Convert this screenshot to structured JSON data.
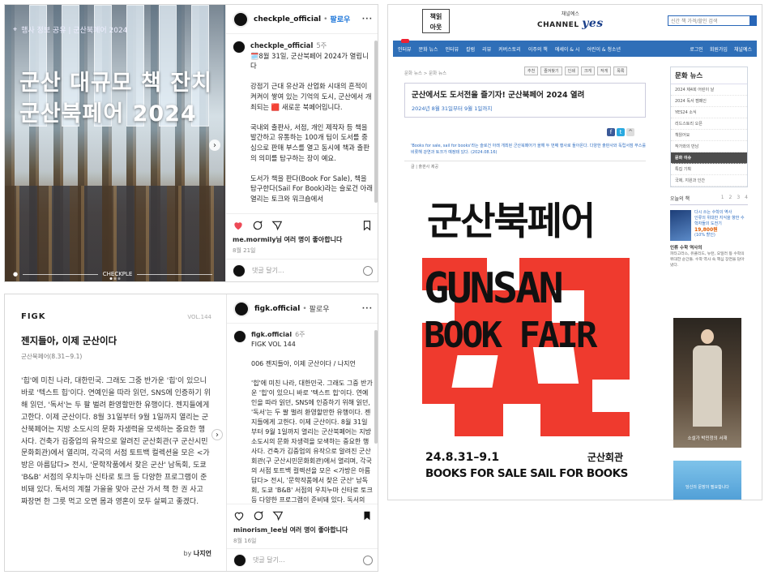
{
  "cardA": {
    "media": {
      "tag": "행사 정보 공유 | 군산북페어 2024",
      "title_line1": "군산 대규모 책 잔치",
      "title_line2": "군산북페어 2024",
      "footer_brand": "CHECKPLE"
    },
    "header": {
      "username": "checkple_official",
      "follow": "팔로우"
    },
    "caption": {
      "username": "checkple_official",
      "age": "5주",
      "text": "🗓️8월 31일, 군산북페어 2024가 열립니다\n\n강점기 근대 유산과 산업화 시대의 흔적이 켜켜이 쌓여 있는 기억의 도시, 군산에서 개최되는 🟥 새로운 북페어입니다.\n\n국내외 출판사, 서점, 개인 제작자 등 책을 발간하고 유통하는 100개 팀이 도서를 중심으로 판매 부스를 열고 동시에 책과 출판의 의미를 탐구하는 장이 예요.\n\n도서가 책을 판다(Book For Sale), 책을 탐구한다(Sail For Book)라는 슬로건 아래 열리는 토크와 워크숍에서\n\n📣 열여덟 명의 문학인, 서점인,"
    },
    "likes": {
      "user": "me.mormily님",
      "rest": "여러 명이 좋아합니다"
    },
    "date": "8월 21일",
    "comment_placeholder": "댓글 달기..."
  },
  "cardB": {
    "brand": "FIGK",
    "vol": "VOL.144",
    "title": "젠지들아, 이제 군산이다",
    "subtitle": "군산북페어(8.31~9.1)",
    "body": "'힙'에 미친 나라, 대한민국. 그래도 그중 반가운 '힙'이 있으니 바로 '텍스트 힙'이다. 연예인을 따라 읽던, SNS에 인증하기 위해 읽던, '독서'는 두 팔 벌려 환영할만한 유행이다. 젠지들에게 고한다. 이제 군산이다. 8월 31일부터 9월 1일까지 열리는 군산북페어는 지방 소도시의 문화 자생력을 모색하는 중요한 행사다. 건축가 김중업의 유작으로 알려진 군산회관(구 군산시민문화회관)에서 열리며, 각국의 서점 토트백 컬렉션을 모은 <가방은 아름답다> 전시, '문학작품에서 찾은 군산' 남독회, 도쿄 'B&B' 서점의 우치누마 신타로 토크 등 다양한 프로그램이 준비돼 있다. 독서의 계절 가을을 맞아 군산 가서 책 한 권 사고 짜장면 한 그릇 먹고 오면 몸과 영혼이 모두 살찌고 좋겠다.",
    "by_prefix": "by",
    "by_author": "나지언",
    "header": {
      "username": "figk.official",
      "follow": "팔로우"
    },
    "caption": {
      "username": "figk.official",
      "age": "6주",
      "vol": "FIGK VOL 144",
      "text": "006 젠지들아, 이제 군산이다 / 나지언\n\n'힙'에 미친 나라, 대한민국. 그래도 그중 반가운 '힙'이 있으니 바로 '텍스트 힙'이다. 연예인을 따라 읽던, SNS에 인증하기 위해 읽던, '독서'는 두 팔 벌려 환영할만한 유행이다. 젠지들에게 고한다. 이제 군산이다. 8월 31일부터 9월 1일까지 열리는 군산북페어는 지방 소도시의 문화 자생력을 모색하는 중요한 행사다. 건축가 김중업의 유작으로 알려진 군산회관(구 군산시민문화회관)에서 열리며, 각국의 서점 토트백 컬렉션을 모은 <가방은 아름답다> 전시, '문학작품에서 찾은 군산' 남독회, 도쿄 'B&B' 서점의 우치누마 신타로 토크 등 다양한 프로그램이 준비돼 있다. 독서의 계절 가을을 맞아 군산 가서 책 한 권 사고 짜장면 한 그릇 먹고 오면 몸과 영혼이 모두 살찌고"
    },
    "likes": {
      "user": "minorism_lee님",
      "rest": "여러 명이 좋아합니다"
    },
    "date": "8월 16일",
    "comment_placeholder": "댓글 달기..."
  },
  "cardC": {
    "logo_line1": "책읽",
    "logo_line2": "아웃",
    "channel_top": "채널예스",
    "channel_name": "CHANNEL",
    "channel_yes": "yes",
    "search_placeholder": "신간 책 가격/할인 검색",
    "nav": [
      "인터뷰",
      "문화 뉴스",
      "인터뷰",
      "칼럼",
      "리뷰",
      "커버스토리",
      "이주의 책",
      "에세이 & 시",
      "어린이 & 청소년"
    ],
    "nav_right": [
      "로그인",
      "회원가입",
      "채널예스"
    ],
    "breadcrumb": "문화 뉴스 > 문화 뉴스",
    "tools": [
      "추천",
      "즐겨찾기",
      "인쇄",
      "크게",
      "작게",
      "목록"
    ],
    "article_title": "군산에서도 도서전을 즐기자! 군산북페어 2024 열려",
    "article_sub": "2024년 8월 31일부터 9월 1일까지",
    "lead": "'Books for sale, sail for books'라는 슬로건 아래 개최된 군산북페어가 올해 두 번째 행사로 돌아온다. 다양한 출판사와 독립서점 부스를 비롯해 강연과 토크가 예정돼 있다. (2024.08.16)",
    "credit": "글 | 출판사 제공",
    "poster": {
      "kr": "군산북페어",
      "en1": "GUNSAN",
      "en2": "BOOK FAIR",
      "date": "24.8.31–9.1",
      "venue": "군산회관",
      "slogan": "BOOKS FOR SALE SAIL FOR BOOKS"
    },
    "aside_title": "문화 뉴스",
    "aside_items": [
      "2024 제4회 어린이 날",
      "2024 독서 캠페인",
      "YES24 소식",
      "리드스토리 오픈",
      "책읽어요",
      "작가와의 만남",
      "문화 이슈",
      "특집 기획",
      "국제, 지원과 인간"
    ],
    "aside_active": 6,
    "today_label": "오늘의 책",
    "today_pages": [
      "1",
      "2",
      "3",
      "4"
    ],
    "book_title": "다시 쓰는 수학의 역사",
    "book_desc": "인류의 위대한 지식을 향한 수학자들의 도전기",
    "book_price": "19,800원",
    "book_discount": "(10% 할인)",
    "blurb_title": "인류 수학 역사의",
    "blurb": "피타고라스, 유클리드, 뉴턴, 오일러 등 수학의 위대한 순간들. 수학 역사 속 핵심 장면을 담아냈다.",
    "ad_caption": "소설가 박민정의 서재",
    "ad2_text": "당신의 문장이 필요합니다"
  }
}
